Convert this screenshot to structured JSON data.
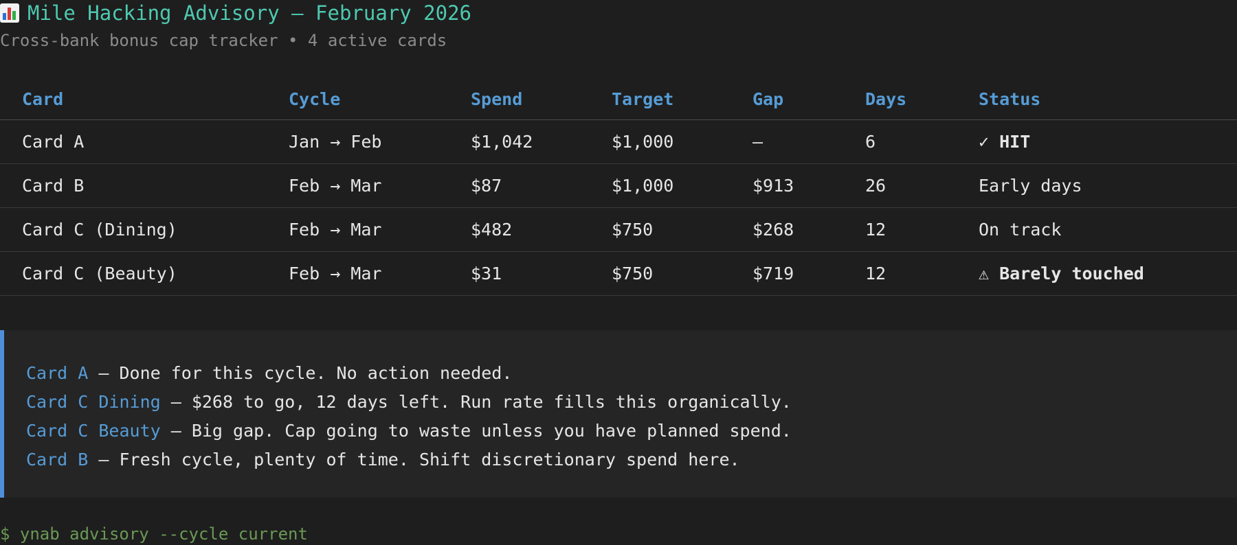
{
  "header": {
    "icon": "bar-chart-icon",
    "title": "Mile Hacking Advisory — February 2026",
    "subtitle": "Cross-bank bonus cap tracker • 4 active cards"
  },
  "table": {
    "columns": [
      "Card",
      "Cycle",
      "Spend",
      "Target",
      "Gap",
      "Days",
      "Status"
    ],
    "rows": [
      {
        "card": "Card A",
        "cycle": "Jan → Feb",
        "spend": "$1,042",
        "target": "$1,000",
        "gap": "—",
        "days": "6",
        "status": "✓ HIT",
        "status_kind": "hit"
      },
      {
        "card": "Card B",
        "cycle": "Feb → Mar",
        "spend": "$87",
        "target": "$1,000",
        "gap": "$913",
        "days": "26",
        "status": "Early days",
        "status_kind": "early"
      },
      {
        "card": "Card C (Dining)",
        "cycle": "Feb → Mar",
        "spend": "$482",
        "target": "$750",
        "gap": "$268",
        "days": "12",
        "status": "On track",
        "status_kind": "ontrack"
      },
      {
        "card": "Card C (Beauty)",
        "cycle": "Feb → Mar",
        "spend": "$31",
        "target": "$750",
        "gap": "$719",
        "days": "12",
        "status": "⚠ Barely touched",
        "status_kind": "barely"
      }
    ]
  },
  "advisory": [
    {
      "card": "Card A",
      "text": " — Done for this cycle. No action needed."
    },
    {
      "card": "Card C Dining",
      "text": " — $268 to go, 12 days left. Run rate fills this organically."
    },
    {
      "card": "Card C Beauty",
      "text": " — Big gap. Cap going to waste unless you have planned spend."
    },
    {
      "card": "Card B",
      "text": " — Fresh cycle, plenty of time. Shift discretionary spend here."
    }
  ],
  "prompt": "$ ynab advisory --cycle current",
  "colors": {
    "background": "#1e1e1e",
    "title": "#4ec9b0",
    "header": "#569cd6",
    "hit": "#4ec9b0",
    "early": "#8b8b8b",
    "ontrack": "#dcdcaa",
    "barely": "#f14c4c",
    "advisory_border": "#4f8fd8",
    "prompt": "#6a9955"
  }
}
